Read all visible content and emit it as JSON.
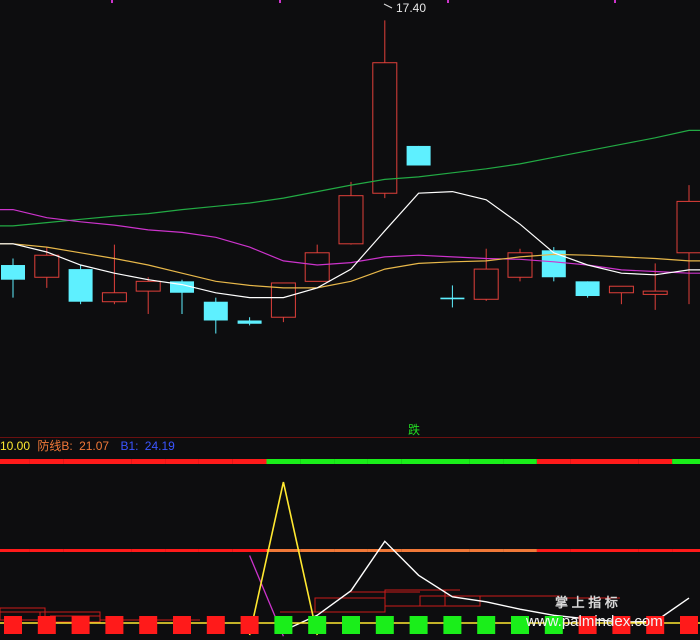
{
  "chart_data": [
    {
      "type": "candlestick",
      "title": "",
      "high_label": "17.40",
      "ylim": [
        12.5,
        17.6
      ],
      "ma_colors": {
        "white": "#ffffff",
        "yellow": "#e8b84a",
        "magenta": "#cc33cc",
        "green": "#22aa44"
      },
      "up_color": "#e0403a",
      "down_color": "#5ef0ff",
      "candles": [
        {
          "o": 14.4,
          "c": 14.22,
          "h": 14.48,
          "l": 14.0
        },
        {
          "o": 14.25,
          "c": 14.52,
          "h": 14.62,
          "l": 14.12
        },
        {
          "o": 14.35,
          "c": 13.95,
          "h": 14.4,
          "l": 13.92
        },
        {
          "o": 13.95,
          "c": 14.06,
          "h": 14.65,
          "l": 13.92
        },
        {
          "o": 14.08,
          "c": 14.2,
          "h": 14.25,
          "l": 13.8
        },
        {
          "o": 14.2,
          "c": 14.06,
          "h": 14.22,
          "l": 13.8
        },
        {
          "o": 13.95,
          "c": 13.72,
          "h": 14.0,
          "l": 13.56
        },
        {
          "o": 13.72,
          "c": 13.68,
          "h": 13.76,
          "l": 13.66
        },
        {
          "o": 13.76,
          "c": 14.18,
          "h": 14.18,
          "l": 13.7
        },
        {
          "o": 14.2,
          "c": 14.55,
          "h": 14.65,
          "l": 14.2
        },
        {
          "o": 14.66,
          "c": 15.25,
          "h": 15.42,
          "l": 14.65
        },
        {
          "o": 15.28,
          "c": 16.88,
          "h": 17.4,
          "l": 15.22
        },
        {
          "o": 15.86,
          "c": 15.62,
          "h": 15.86,
          "l": 15.62
        },
        {
          "o": 14.0,
          "c": 13.98,
          "h": 14.15,
          "l": 13.88
        },
        {
          "o": 13.98,
          "c": 14.35,
          "h": 14.6,
          "l": 13.96
        },
        {
          "o": 14.25,
          "c": 14.55,
          "h": 14.6,
          "l": 14.2
        },
        {
          "o": 14.58,
          "c": 14.25,
          "h": 14.62,
          "l": 14.2
        },
        {
          "o": 14.2,
          "c": 14.02,
          "h": 14.2,
          "l": 14.0
        },
        {
          "o": 14.06,
          "c": 14.14,
          "h": 14.14,
          "l": 13.92
        },
        {
          "o": 14.04,
          "c": 14.08,
          "h": 14.42,
          "l": 13.85
        },
        {
          "o": 14.55,
          "c": 15.18,
          "h": 15.38,
          "l": 13.92
        }
      ],
      "ma_white": [
        14.66,
        14.56,
        14.4,
        14.3,
        14.22,
        14.16,
        14.06,
        14.0,
        14.0,
        14.12,
        14.35,
        14.82,
        15.28,
        15.3,
        15.2,
        14.9,
        14.55,
        14.4,
        14.3,
        14.28,
        14.34
      ],
      "ma_yellow": [
        14.66,
        14.62,
        14.55,
        14.48,
        14.4,
        14.3,
        14.2,
        14.15,
        14.12,
        14.12,
        14.2,
        14.35,
        14.42,
        14.44,
        14.45,
        14.5,
        14.53,
        14.52,
        14.5,
        14.48,
        14.45
      ],
      "ma_magenta": [
        15.08,
        14.98,
        14.93,
        14.89,
        14.83,
        14.8,
        14.74,
        14.62,
        14.45,
        14.4,
        14.43,
        14.5,
        14.52,
        14.5,
        14.48,
        14.47,
        14.44,
        14.4,
        14.34,
        14.32,
        14.3
      ],
      "ma_green": [
        14.88,
        14.92,
        14.96,
        15.0,
        15.03,
        15.08,
        15.12,
        15.16,
        15.22,
        15.3,
        15.38,
        15.45,
        15.48,
        15.53,
        15.58,
        15.64,
        15.72,
        15.8,
        15.88,
        15.96,
        16.05
      ]
    },
    {
      "type": "indicator",
      "header": {
        "first_value": "10.00",
        "line_b_label": "防线B:",
        "line_b_value": "21.07",
        "b1_label": "B1:",
        "b1_value": "24.19"
      },
      "signal_text": "跌",
      "ylim": [
        0,
        30
      ],
      "top_band": [
        "red",
        "red",
        "red",
        "red",
        "red",
        "red",
        "red",
        "red",
        "green",
        "green",
        "green",
        "green",
        "green",
        "green",
        "green",
        "green",
        "red",
        "red",
        "red",
        "red",
        "green"
      ],
      "upper_line_colors": [
        "red",
        "red",
        "red",
        "red",
        "red",
        "red",
        "red",
        "red",
        "orange",
        "orange",
        "orange",
        "orange",
        "orange",
        "orange",
        "orange",
        "orange",
        "red",
        "red",
        "red",
        "red",
        "red"
      ],
      "white_line": [
        null,
        null,
        null,
        null,
        null,
        null,
        null,
        null,
        1.5,
        4.0,
        8.0,
        16.0,
        10.5,
        7.0,
        6.2,
        5.0,
        4.0,
        3.4,
        2.9,
        3.0,
        6.8
      ],
      "yellow_line": [
        null,
        null,
        null,
        null,
        null,
        null,
        null,
        0.8,
        25.6,
        0.8,
        null,
        null,
        null,
        null,
        null,
        null,
        null,
        null,
        null,
        null,
        null
      ],
      "magenta_line": [
        null,
        null,
        null,
        null,
        null,
        null,
        null,
        13.7,
        0.6,
        null,
        null,
        null,
        null,
        null,
        null,
        null,
        null,
        null,
        null,
        null,
        null
      ],
      "bottom_blocks": [
        "red",
        "red",
        "red",
        "red",
        "red",
        "red",
        "red",
        "red",
        "green",
        "green",
        "green",
        "green",
        "green",
        "green",
        "green",
        "green",
        "green",
        "red",
        "red",
        "red",
        "red"
      ],
      "colors": {
        "red": "#ff1a1a",
        "green": "#1aee1a",
        "orange": "#f07838",
        "white": "#ffffff",
        "yellow": "#ffe830",
        "magenta": "#cc33cc",
        "header_first": "#ffe830",
        "header_b": "#f07838",
        "header_b1": "#3b55ff"
      }
    }
  ],
  "watermark": {
    "line1": "掌  上  指  标",
    "line2": "www.palmindex.com"
  }
}
